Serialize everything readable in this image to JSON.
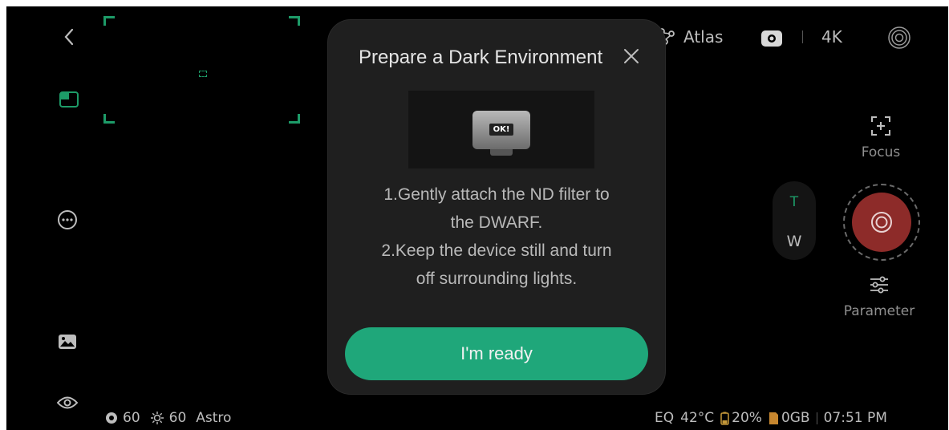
{
  "top_bar": {
    "target_label": "Atlas",
    "resolution": "4K"
  },
  "right_controls": {
    "focus_label": "Focus",
    "zoom_tele": "T",
    "zoom_wide": "W",
    "parameter_label": "Parameter"
  },
  "status_left": {
    "exposure_value": "60",
    "gain_value": "60",
    "mode": "Astro"
  },
  "status_right": {
    "mount": "EQ",
    "temperature": "42°C",
    "battery": "20%",
    "storage": "0GB",
    "time": "07:51 PM"
  },
  "modal": {
    "title": "Prepare a Dark Environment",
    "image_screen_text": "OK!",
    "step1_line1": "1.Gently attach the ND filter to",
    "step1_line2": "the DWARF.",
    "step2_line1": "2.Keep the device still and turn",
    "step2_line2": "off surrounding lights.",
    "confirm_label": "I'm ready"
  },
  "colors": {
    "accent": "#1fa77a",
    "frame": "#1d9b68",
    "shutter": "#8d2b29",
    "background": "#000000",
    "modal_bg": "#1f1f1f"
  },
  "icons": [
    "back-icon",
    "layout-icon",
    "more-icon",
    "gallery-icon",
    "eye-icon",
    "target-icon",
    "camera-icon",
    "record-icon",
    "focus-icon",
    "shutter-icon",
    "parameter-icon",
    "close-icon",
    "gain-icon",
    "exposure-icon",
    "battery-icon",
    "storage-icon"
  ]
}
